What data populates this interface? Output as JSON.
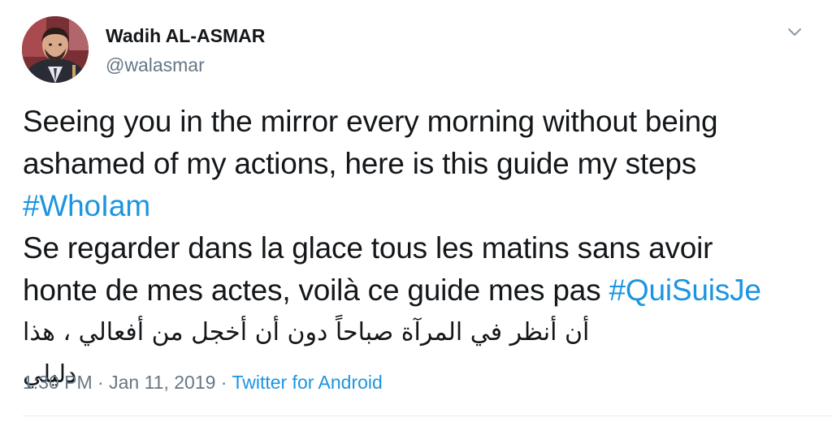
{
  "author": {
    "display_name": "Wadih AL-ASMAR",
    "handle": "@walasmar"
  },
  "tweet": {
    "line1": "Seeing you in the mirror every morning without being",
    "line2": "ashamed of my actions, here is this guide my steps",
    "hashtag1": "#WhoIam",
    "line4": "Se regarder dans la glace tous les matins sans avoir",
    "line5_text": "honte de mes actes, voilà ce guide mes pas ",
    "hashtag2": "#QuiSuisJe",
    "arabic": "أن أنظر في المرآة صباحاً دون أن أخجل من أفعالي ، هذا دليلي"
  },
  "meta": {
    "time": "1:30 PM",
    "sep1": " · ",
    "date": "Jan 11, 2019",
    "sep2": " · ",
    "source": "Twitter for Android"
  },
  "icons": {
    "avatar": "profile-photo",
    "caret": "chevron-down-icon"
  },
  "colors": {
    "link": "#1b95e0",
    "secondary": "#657786",
    "text": "#14171a"
  }
}
